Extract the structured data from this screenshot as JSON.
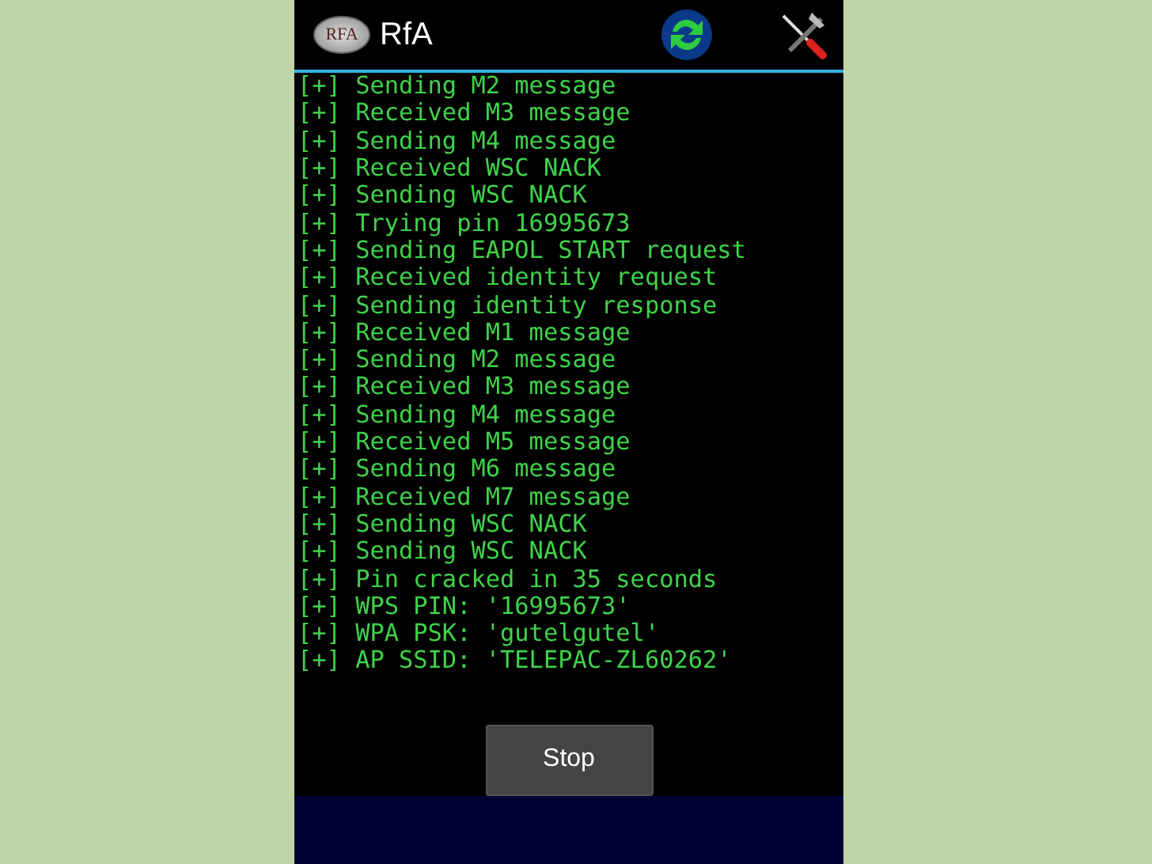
{
  "app_bar": {
    "logo_text": "RFA",
    "title": "RfA"
  },
  "log_lines": [
    "[+] Sending M2 message",
    "[+] Received M3 message",
    "[+] Sending M4 message",
    "[+] Received WSC NACK",
    "[+] Sending WSC NACK",
    "[+] Trying pin 16995673",
    "[+] Sending EAPOL START request",
    "[+] Received identity request",
    "[+] Sending identity response",
    "[+] Received M1 message",
    "[+] Sending M2 message",
    "[+] Received M3 message",
    "[+] Sending M4 message",
    "[+] Received M5 message",
    "[+] Sending M6 message",
    "[+] Received M7 message",
    "[+] Sending WSC NACK",
    "[+] Sending WSC NACK",
    "[+] Pin cracked in 35 seconds",
    "[+] WPS PIN: '16995673'",
    "[+] WPA PSK: 'gutelgutel'",
    "[+] AP SSID: 'TELEPAC-ZL60262'"
  ],
  "stop_button": "Stop"
}
